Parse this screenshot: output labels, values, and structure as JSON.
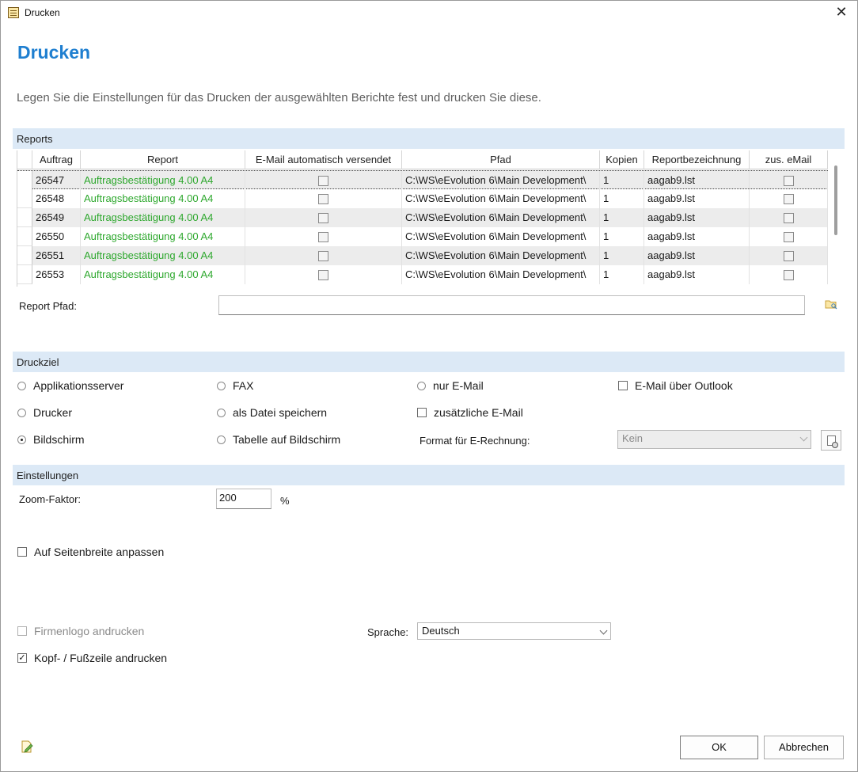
{
  "window": {
    "title": "Drucken"
  },
  "heading": "Drucken",
  "intro": "Legen Sie die Einstellungen für das Drucken der ausgewählten Berichte fest und drucken Sie diese.",
  "sections": {
    "reports": "Reports",
    "druckziel": "Druckziel",
    "einstellungen": "Einstellungen"
  },
  "grid": {
    "columns": [
      "Auftrag",
      "Report",
      "E-Mail automatisch versendet",
      "Pfad",
      "Kopien",
      "Reportbezeichnung",
      "zus. eMail"
    ],
    "rows": [
      {
        "auftrag": "26547",
        "report": "Auftragsbestätigung 4.00 A4",
        "pfad": "C:\\WS\\eEvolution 6\\Main Development\\",
        "kopien": "1",
        "bezeichnung": "aagab9.lst"
      },
      {
        "auftrag": "26548",
        "report": "Auftragsbestätigung 4.00 A4",
        "pfad": "C:\\WS\\eEvolution 6\\Main Development\\",
        "kopien": "1",
        "bezeichnung": "aagab9.lst"
      },
      {
        "auftrag": "26549",
        "report": "Auftragsbestätigung 4.00 A4",
        "pfad": "C:\\WS\\eEvolution 6\\Main Development\\",
        "kopien": "1",
        "bezeichnung": "aagab9.lst"
      },
      {
        "auftrag": "26550",
        "report": "Auftragsbestätigung 4.00 A4",
        "pfad": "C:\\WS\\eEvolution 6\\Main Development\\",
        "kopien": "1",
        "bezeichnung": "aagab9.lst"
      },
      {
        "auftrag": "26551",
        "report": "Auftragsbestätigung 4.00 A4",
        "pfad": "C:\\WS\\eEvolution 6\\Main Development\\",
        "kopien": "1",
        "bezeichnung": "aagab9.lst"
      },
      {
        "auftrag": "26553",
        "report": "Auftragsbestätigung 4.00 A4",
        "pfad": "C:\\WS\\eEvolution 6\\Main Development\\",
        "kopien": "1",
        "bezeichnung": "aagab9.lst"
      }
    ]
  },
  "report_pfad": {
    "label": "Report Pfad:",
    "value": ""
  },
  "druckziel": {
    "applikationsserver": "Applikationsserver",
    "drucker": "Drucker",
    "bildschirm": "Bildschirm",
    "fax": "FAX",
    "als_datei": "als Datei speichern",
    "tabelle": "Tabelle auf Bildschirm",
    "nur_email": "nur E-Mail",
    "zusaetzliche_email": "zusätzliche E-Mail",
    "email_outlook": "E-Mail über Outlook",
    "format_label": "Format für E-Rechnung:",
    "format_value": "Kein",
    "selected": "Bildschirm"
  },
  "einstellungen": {
    "zoom_label": "Zoom-Faktor:",
    "zoom_value": "200",
    "zoom_unit": "%",
    "seitenbreite": "Auf Seitenbreite anpassen",
    "firmenlogo": "Firmenlogo andrucken",
    "kopf_fuss": "Kopf- / Fußzeile andrucken",
    "sprache_label": "Sprache:",
    "sprache_value": "Deutsch"
  },
  "buttons": {
    "ok": "OK",
    "abbrechen": "Abbrechen"
  }
}
